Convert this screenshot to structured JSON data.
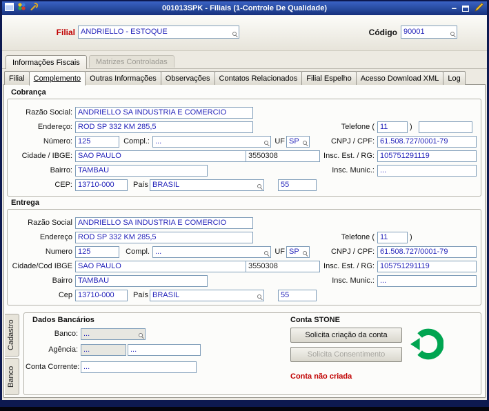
{
  "titlebar": {
    "title": "001013SPK - Filiais (1-Controle De Qualidade)",
    "minimize_glyph": "–"
  },
  "header": {
    "filial_label": "Filial",
    "filial_value": "ANDRIELLO - ESTOQUE",
    "codigo_label": "Código",
    "codigo_value": "90001"
  },
  "tabs1": [
    "Informações Fiscais",
    "Matrizes Controladas"
  ],
  "tabs2": [
    "Filial",
    "Complemento",
    "Outras Informações",
    "Observações",
    "Contatos Relacionados",
    "Filial Espelho",
    "Acesso Download XML",
    "Log"
  ],
  "cobranca": {
    "title": "Cobrança",
    "razao_label": "Razão Social:",
    "razao_value": "ANDRIELLO SA INDUSTRIA E COMERCIO",
    "endereco_label": "Endereço:",
    "endereco_value": "ROD SP 332 KM 285,5",
    "numero_label": "Número:",
    "numero_value": "125",
    "compl_label": "Compl.:",
    "compl_value": "...",
    "uf_label": "UF",
    "uf_value": "SP",
    "cidade_label": "Cidade / IBGE:",
    "cidade_value": "SAO PAULO",
    "ibge_value": "3550308",
    "bairro_label": "Bairro:",
    "bairro_value": "TAMBAU",
    "cep_label": "CEP:",
    "cep_value": "13710-000",
    "pais_label": "País",
    "pais_value": "BRASIL",
    "ddi_value": "55",
    "telefone_label": "Telefone (",
    "ddd_value": "11",
    "paren_close": ")",
    "telefone_value": "",
    "cnpj_label": "CNPJ / CPF:",
    "cnpj_value": "61.508.727/0001-79",
    "inscest_label": "Insc. Est. / RG:",
    "inscest_value": "105751291119",
    "inscmun_label": "Insc. Munic.:",
    "inscmun_value": "..."
  },
  "entrega": {
    "title": "Entrega",
    "razao_label": "Razão Social",
    "razao_value": "ANDRIELLO SA INDUSTRIA E COMERCIO",
    "endereco_label": "Endereço",
    "endereco_value": "ROD SP 332 KM 285,5",
    "numero_label": "Numero",
    "numero_value": "125",
    "compl_label": "Compl.",
    "compl_value": "...",
    "uf_label": "UF",
    "uf_value": "SP",
    "cidade_label": "Cidade/Cod IBGE",
    "cidade_value": "SAO PAULO",
    "ibge_value": "3550308",
    "bairro_label": "Bairro",
    "bairro_value": "TAMBAU",
    "cep_label": "Cep",
    "cep_value": "13710-000",
    "pais_label": "País",
    "pais_value": "BRASIL",
    "ddi_value": "55",
    "telefone_label": "Telefone (",
    "ddd_value": "11",
    "paren_close": ")",
    "cnpj_label": "CNPJ / CPF:",
    "cnpj_value": "61.508.727/0001-79",
    "inscest_label": "Insc. Est. / RG:",
    "inscest_value": "105751291119",
    "inscmun_label": "Insc. Munic.:",
    "inscmun_value": "..."
  },
  "bottom": {
    "vtab_cadastro": "Cadastro",
    "vtab_banco": "Banco",
    "dados_title": "Dados Bancários",
    "banco_label": "Banco:",
    "banco_value": "...",
    "agencia_label": "Agência:",
    "agencia_value": "...",
    "agencia_value2": "...",
    "conta_label": "Conta Corrente:",
    "conta_value": "...",
    "stone_title": "Conta STONE",
    "btn_solicita_criacao": "Solicita criação da conta",
    "btn_solicita_consentimento": "Solicita Consentimento",
    "status": "Conta não criada"
  },
  "colors": {
    "titlebar_blue": "#274a9e",
    "field_text_blue": "#2424ba",
    "filial_label_red": "#c00000",
    "status_red": "#c00000",
    "stone_green": "#00A551"
  },
  "icons": {
    "lookup": "magnifier",
    "edit": "pencil",
    "stone": "green-arc-triangle"
  }
}
